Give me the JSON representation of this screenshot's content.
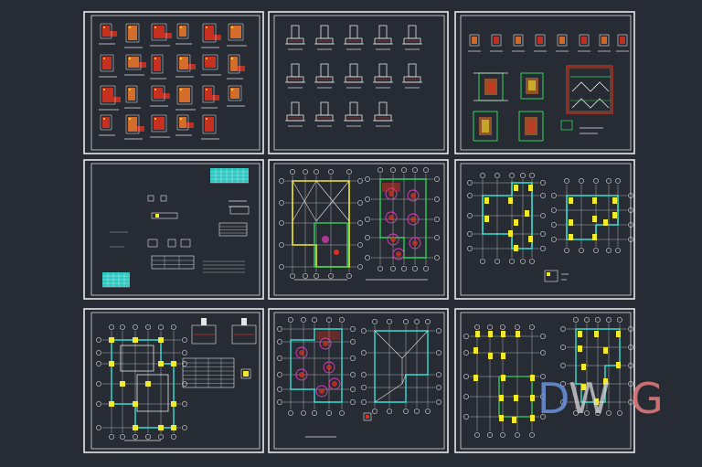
{
  "watermark": {
    "letters": [
      "D",
      "W",
      "G"
    ],
    "colors": [
      "#6a8fd8",
      "#d8d8d8",
      "#e07a7a"
    ]
  },
  "sheets": [
    {
      "id": 1,
      "kind": "column-details"
    },
    {
      "id": 2,
      "kind": "foundation-details"
    },
    {
      "id": 3,
      "kind": "stair-details"
    },
    {
      "id": 4,
      "kind": "general-notes"
    },
    {
      "id": 5,
      "kind": "slab-plan"
    },
    {
      "id": 6,
      "kind": "beam-plan"
    },
    {
      "id": 7,
      "kind": "foundation-plan"
    },
    {
      "id": 8,
      "kind": "roof-slab-plan"
    },
    {
      "id": 9,
      "kind": "column-plan"
    }
  ],
  "colors": {
    "background": "#262b34",
    "line": "#e6e6e6",
    "red": "#d9301f",
    "orange": "#e8742a",
    "yellow": "#f2ea2a",
    "cyan": "#39e0d6",
    "green": "#31d35a",
    "magenta": "#e93cc0"
  }
}
